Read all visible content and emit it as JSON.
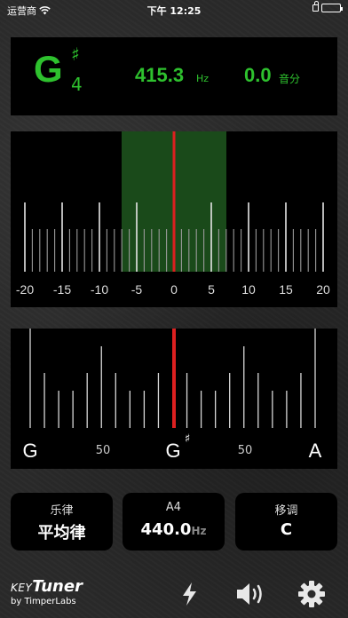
{
  "status_bar": {
    "carrier": "运营商",
    "time": "下午 12:25"
  },
  "display": {
    "note_letter": "G",
    "note_accidental": "♯",
    "note_octave": "4",
    "frequency": "415.3",
    "frequency_unit": "Hz",
    "cents": "0.0",
    "cents_unit": "音分",
    "accent_color": "#2ec12e"
  },
  "fine_meter": {
    "tick_labels": [
      "-20",
      "-15",
      "-10",
      "-5",
      "0",
      "5",
      "10",
      "15",
      "20"
    ],
    "needle_value": 0,
    "range": [
      -20,
      20
    ]
  },
  "coarse_meter": {
    "left_note": "G",
    "center_note": "G",
    "center_accidental": "♯",
    "right_note": "A",
    "left_mid_label": "50",
    "right_mid_label": "50",
    "needle_value": 0
  },
  "controls": {
    "temperament": {
      "label": "乐律",
      "value": "平均律"
    },
    "reference": {
      "label": "A4",
      "value": "440.0",
      "unit": "Hz"
    },
    "transpose": {
      "label": "移调",
      "value": "C"
    }
  },
  "branding": {
    "key": "KEY",
    "tuner": "Tuner",
    "by": "by TimperLabs"
  },
  "toolbar": {
    "icons": [
      "flash-icon",
      "speaker-icon",
      "gear-icon"
    ]
  }
}
